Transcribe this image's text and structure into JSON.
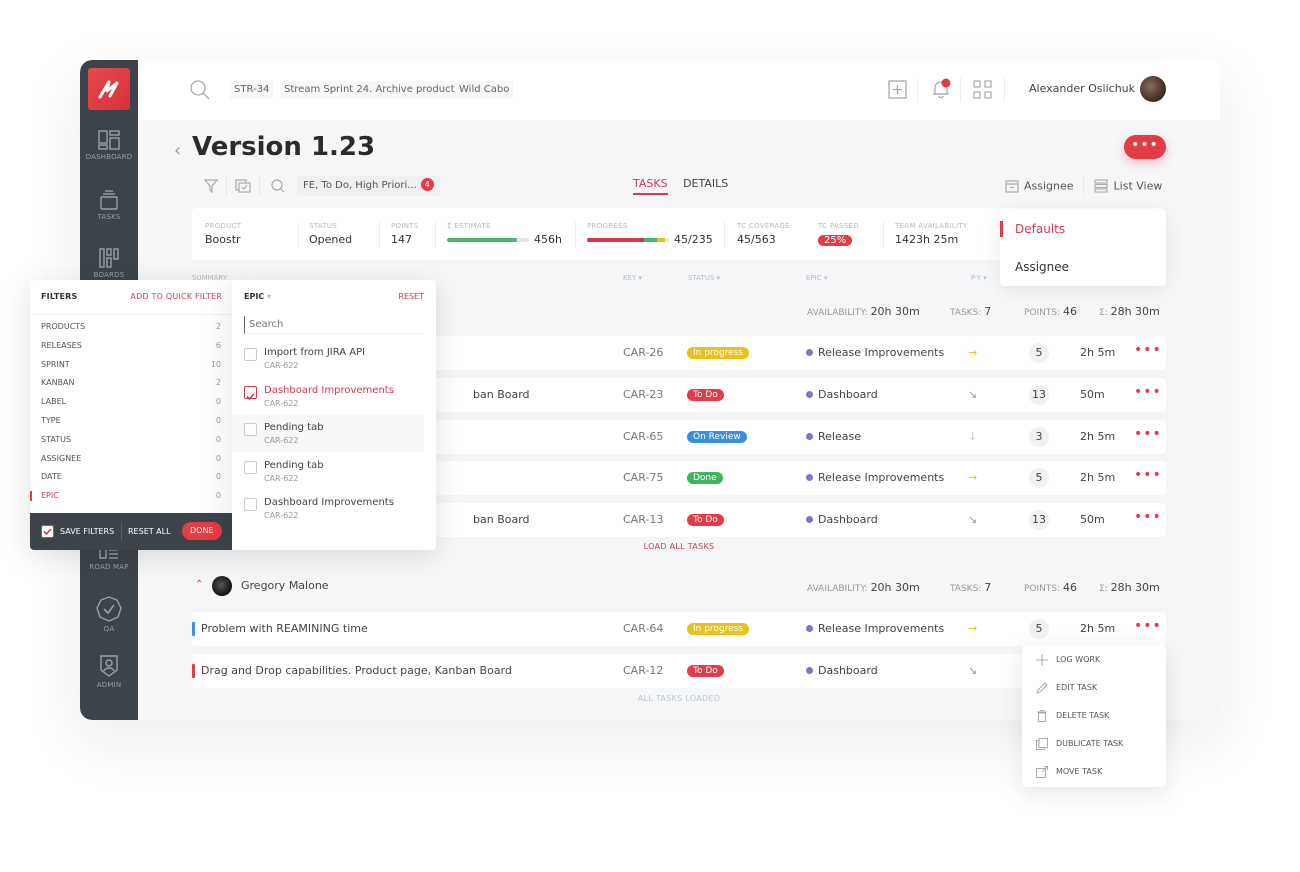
{
  "sidebar": {
    "items": [
      {
        "label": "DASHBOARD",
        "icon": "dashboard-icon"
      },
      {
        "label": "TASKS",
        "icon": "tasks-icon"
      },
      {
        "label": "BOARDS",
        "icon": "boards-icon"
      },
      {
        "label": "ROAD MAP",
        "icon": "roadmap-icon"
      },
      {
        "label": "QA",
        "icon": "qa-badge-icon"
      },
      {
        "label": "ADMIN",
        "icon": "admin-icon"
      }
    ]
  },
  "topbar": {
    "chips": [
      "STR-34",
      "Stream Sprint 24. Archive product",
      "Wild Cabo"
    ],
    "user_name": "Alexander Osiichuk"
  },
  "page": {
    "title": "Version 1.23",
    "filter_chip": "FE, To Do, High Priori...",
    "filter_count": "4",
    "more_label": "•••",
    "tabs": [
      {
        "label": "TASKS",
        "active": true
      },
      {
        "label": "DETAILS",
        "active": false
      }
    ],
    "group_by_label": "Assignee",
    "view_label": "List View"
  },
  "stats": {
    "product": {
      "label": "PRODUCT",
      "value": "Boostr"
    },
    "status": {
      "label": "STATUS",
      "value": "Opened"
    },
    "points": {
      "label": "POINTS",
      "value": "147"
    },
    "estimate": {
      "label": "Σ ESTIMATE",
      "value": "456h",
      "fill_fraction": 0.85
    },
    "progress": {
      "label": "PROGRESS",
      "value": "45/235",
      "segments": [
        {
          "color": "#d8344a",
          "fraction": 0.7
        },
        {
          "color": "#4cb56b",
          "fraction": 0.15
        },
        {
          "color": "#e3c81b",
          "fraction": 0.1
        }
      ]
    },
    "tc_coverage": {
      "label": "TC COVERAGE",
      "value": "45/563"
    },
    "tc_passed": {
      "label": "TC PASSED",
      "value": "25%"
    },
    "team_availability": {
      "label": "TEAM AVAILABILITY",
      "value": "1423h 25m"
    }
  },
  "table": {
    "headers": [
      "SUMMARY",
      "KEY",
      "STATUS",
      "EPIC",
      "P-Y"
    ],
    "groups": [
      {
        "name": "",
        "availability_label": "AVAILABILITY:",
        "availability": "20h 30m",
        "tasks_label": "TASKS:",
        "tasks": "7",
        "points_label": "POINTS:",
        "points": "46",
        "sum_label": "Σ:",
        "sum": "28h 30m",
        "rows": [
          {
            "summary": "",
            "key": "CAR-26",
            "status": "In progress",
            "epic": "Release Improvements",
            "priority": "→",
            "points": "5",
            "time": "2h 5m"
          },
          {
            "summary": "ban Board",
            "key": "CAR-23",
            "status": "To Do",
            "epic": "Dashboard",
            "priority": "↘",
            "points": "13",
            "time": "50m"
          },
          {
            "summary": "",
            "key": "CAR-65",
            "status": "On Review",
            "epic": "Release",
            "priority": "↓",
            "points": "3",
            "time": "2h 5m"
          },
          {
            "summary": "",
            "key": "CAR-75",
            "status": "Done",
            "epic": "Release Improvements",
            "priority": "→",
            "points": "5",
            "time": "2h 5m"
          },
          {
            "summary": "ban Board",
            "key": "CAR-13",
            "status": "To Do",
            "epic": "Dashboard",
            "priority": "↘",
            "points": "13",
            "time": "50m"
          }
        ],
        "footer": "LOAD ALL TASKS"
      },
      {
        "name": "Gregory Malone",
        "availability_label": "AVAILABILITY:",
        "availability": "20h 30m",
        "tasks_label": "TASKS:",
        "tasks": "7",
        "points_label": "POINTS:",
        "points": "46",
        "sum_label": "Σ:",
        "sum": "28h 30m",
        "rows": [
          {
            "summary": "Problem with REAMINING time",
            "key": "CAR-64",
            "status": "In progress",
            "epic": "Release Improvements",
            "priority": "→",
            "points": "5",
            "time": "2h 5m"
          },
          {
            "summary": "Drag and Drop capabilities. Product page, Kanban Board",
            "key": "CAR-12",
            "status": "To Do",
            "epic": "Dashboard",
            "priority": "↘",
            "points": "",
            "time": ""
          }
        ],
        "footer": "ALL TASKS LOADED"
      }
    ],
    "dots": "•••"
  },
  "group_dropdown": {
    "options": [
      "Defaults",
      "Assignee"
    ],
    "selected": "Defaults"
  },
  "context_menu": {
    "items": [
      "LOG WORK",
      "EDIT TASK",
      "DELETE TASK",
      "DUBLICATE TASK",
      "MOVE TASK"
    ]
  },
  "filters": {
    "title": "FILTERS",
    "add_quick": "ADD TO QUICK FILTER",
    "items": [
      {
        "label": "PRODUCTS",
        "count": "2"
      },
      {
        "label": "RELEASES",
        "count": "6"
      },
      {
        "label": "SPRINT",
        "count": "10"
      },
      {
        "label": "KANBAN",
        "count": "2"
      },
      {
        "label": "LABEL",
        "count": "0"
      },
      {
        "label": "TYPE",
        "count": "0"
      },
      {
        "label": "STATUS",
        "count": "0"
      },
      {
        "label": "ASSIGNEE",
        "count": "0"
      },
      {
        "label": "DATE",
        "count": "0"
      },
      {
        "label": "EPIC",
        "count": "0",
        "active": true
      }
    ],
    "save_filters": "SAVE FILTERS",
    "reset_all": "RESET ALL",
    "done": "DONE"
  },
  "epic_panel": {
    "title": "EPIC",
    "reset": "RESET",
    "search_placeholder": "Search",
    "items": [
      {
        "name": "Import from JIRA API",
        "key": "CAR-622",
        "checked": false
      },
      {
        "name": "Dashboard Improvements",
        "key": "CAR-622",
        "checked": true
      },
      {
        "name": "Pending tab",
        "key": "CAR-622",
        "checked": false
      },
      {
        "name": "Pending tab",
        "key": "CAR-622",
        "checked": false
      },
      {
        "name": "Dashboard Improvements",
        "key": "CAR-622",
        "checked": false
      }
    ]
  },
  "colors": {
    "accent": "#e23c44",
    "in_progress": "#e8c21a",
    "todo": "#e23c4a",
    "on_review": "#3b8fe0",
    "done": "#3fb35e",
    "epic": "#8b6fd0"
  }
}
